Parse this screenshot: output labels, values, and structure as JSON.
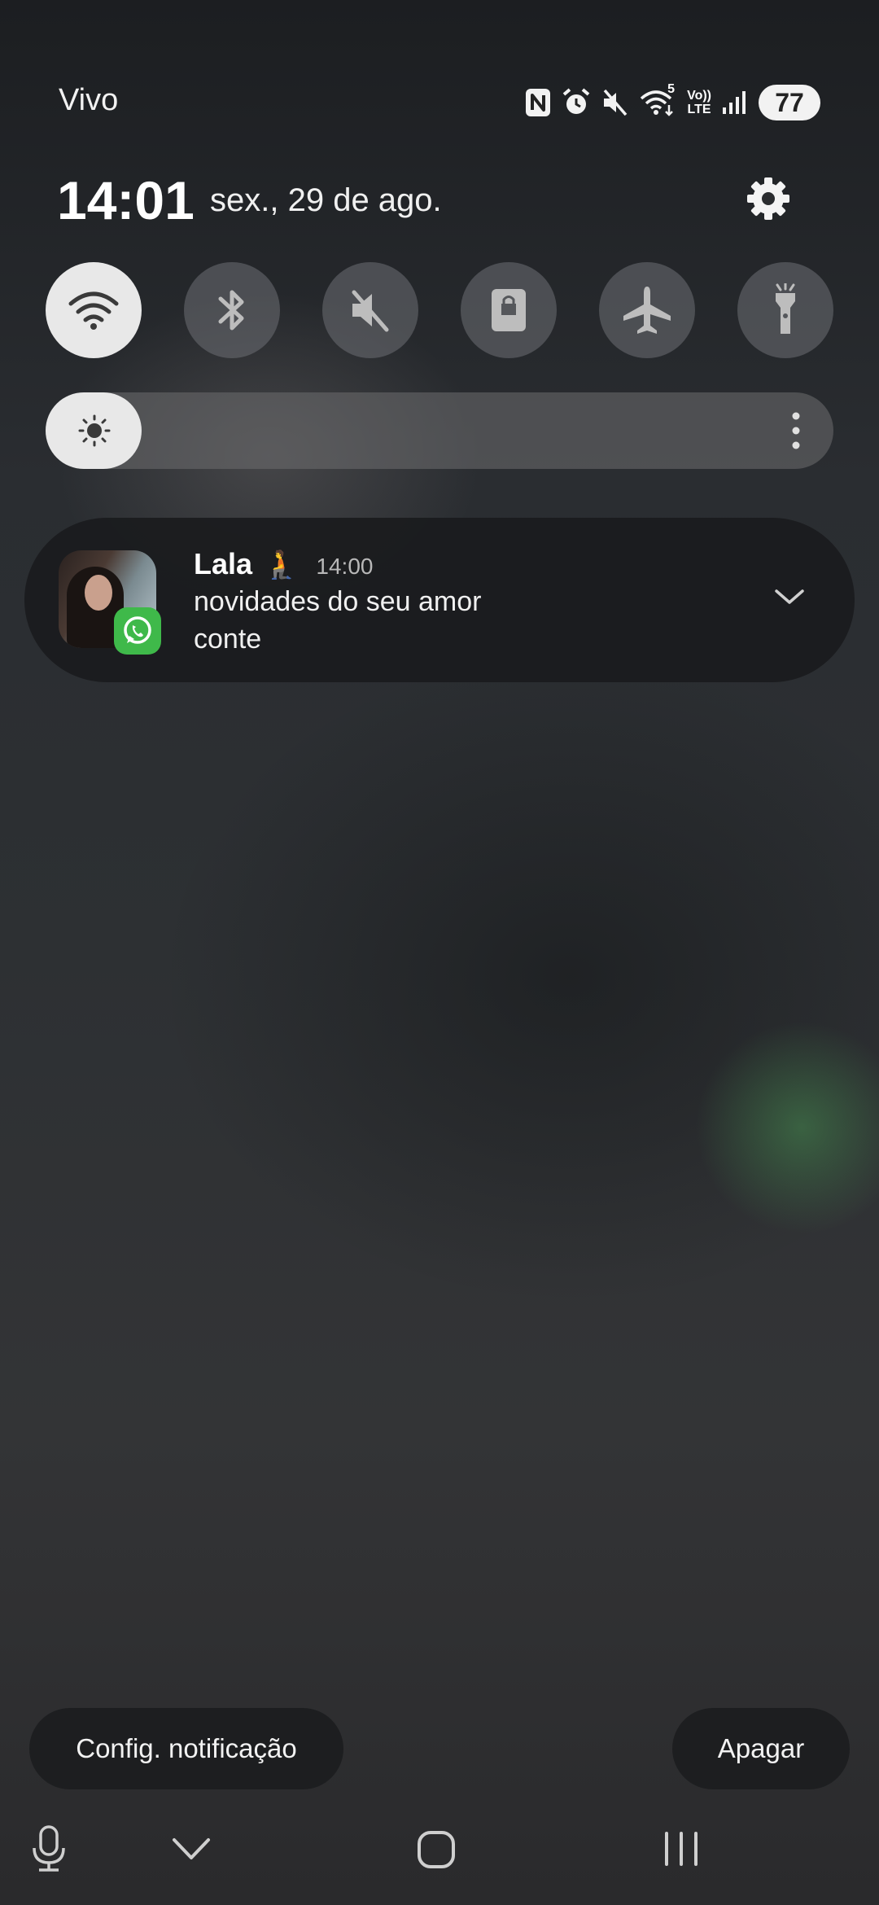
{
  "status_bar": {
    "carrier": "Vivo",
    "battery": "77",
    "icons": [
      "nfc-icon",
      "alarm-icon",
      "mute-icon",
      "wifi-icon",
      "volte-icon",
      "signal-icon"
    ],
    "wifi_band": "5",
    "volte_top": "Vo))",
    "volte_bottom": "LTE"
  },
  "header": {
    "time": "14:01",
    "date": "sex., 29 de ago."
  },
  "quick_settings": [
    {
      "name": "wifi",
      "icon": "wifi-icon",
      "active": true
    },
    {
      "name": "bluetooth",
      "icon": "bluetooth-icon",
      "active": false
    },
    {
      "name": "sound",
      "icon": "mute-icon",
      "active": false
    },
    {
      "name": "lock",
      "icon": "lock-icon",
      "active": false
    },
    {
      "name": "airplane-mode",
      "icon": "airplane-icon",
      "active": false
    },
    {
      "name": "flashlight",
      "icon": "flashlight-icon",
      "active": false
    }
  ],
  "brightness": {
    "level": 0.08,
    "icon": "sun-icon"
  },
  "notification": {
    "sender": "Lala",
    "emoji": "🧎",
    "time": "14:00",
    "line1": "novidades do seu amor",
    "line2": "conte",
    "app_icon": "whatsapp-icon",
    "colors": {
      "badge": "#3fb94a"
    }
  },
  "actions": {
    "config_label": "Config. notificação",
    "clear_label": "Apagar"
  },
  "nav_bar": {
    "icons": [
      "microphone-icon",
      "chevron-down-icon",
      "home-icon",
      "recents-icon"
    ]
  }
}
